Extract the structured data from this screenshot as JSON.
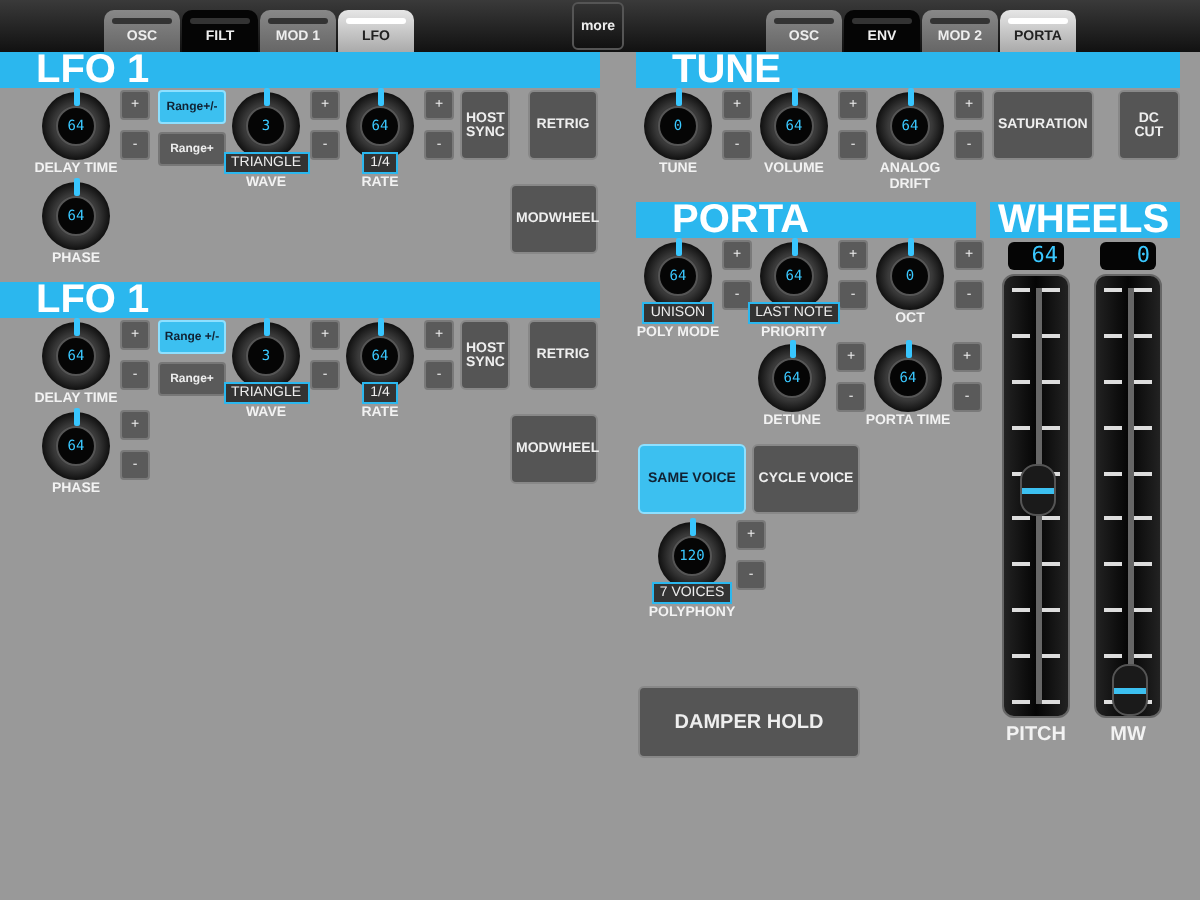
{
  "tabs_left": [
    {
      "label": "OSC",
      "selected": false,
      "dark": false
    },
    {
      "label": "FILT",
      "selected": false,
      "dark": true
    },
    {
      "label": "MOD 1",
      "selected": false,
      "dark": false
    },
    {
      "label": "LFO",
      "selected": true,
      "dark": false
    }
  ],
  "more": "more",
  "tabs_right": [
    {
      "label": "OSC",
      "selected": false,
      "dark": false
    },
    {
      "label": "ENV",
      "selected": false,
      "dark": true
    },
    {
      "label": "MOD 2",
      "selected": false,
      "dark": false
    },
    {
      "label": "PORTA",
      "selected": true,
      "dark": false
    }
  ],
  "lfo_sections": [
    {
      "title": "LFO 1",
      "delay": {
        "value": "64",
        "label": "DELAY TIME",
        "stepper": [
          "+",
          "-"
        ]
      },
      "range_buttons": [
        {
          "label": "Range+/-",
          "selected": true
        },
        {
          "label": "Range+",
          "selected": false
        }
      ],
      "wave": {
        "value": "3",
        "display": "TRIANGLE",
        "label": "WAVE",
        "stepper": [
          "+",
          "-"
        ]
      },
      "rate": {
        "value": "64",
        "display": "1/4",
        "label": "RATE",
        "stepper": [
          "+",
          "-"
        ]
      },
      "host_sync": "HOST SYNC",
      "retrig": "RETRIG",
      "modwheel": "MODWHEEL",
      "phase": {
        "value": "64",
        "label": "PHASE"
      }
    },
    {
      "title": "LFO 1",
      "delay": {
        "value": "64",
        "label": "DELAY TIME",
        "stepper": [
          "+",
          "-"
        ]
      },
      "range_buttons": [
        {
          "label": "Range +/-",
          "selected": true
        },
        {
          "label": "Range+",
          "selected": false
        }
      ],
      "wave": {
        "value": "3",
        "display": "TRIANGLE",
        "label": "WAVE",
        "stepper": [
          "+",
          "-"
        ]
      },
      "rate": {
        "value": "64",
        "display": "1/4",
        "label": "RATE",
        "stepper": [
          "+",
          "-"
        ]
      },
      "host_sync": "HOST SYNC",
      "retrig": "RETRIG",
      "modwheel": "MODWHEEL",
      "phase": {
        "value": "64",
        "label": "PHASE",
        "stepper": [
          "+",
          "-"
        ]
      }
    }
  ],
  "tune": {
    "title": "TUNE",
    "knobs": [
      {
        "value": "0",
        "label": "TUNE",
        "stepper": [
          "+",
          "-"
        ]
      },
      {
        "value": "64",
        "label": "VOLUME",
        "stepper": [
          "+",
          "-"
        ]
      },
      {
        "value": "64",
        "label": "ANALOG DRIFT",
        "stepper": [
          "+",
          "-"
        ]
      }
    ],
    "buttons": [
      "SATURATION",
      "DC CUT"
    ]
  },
  "porta": {
    "title": "PORTA",
    "knobs_row1": [
      {
        "value": "64",
        "display": "UNISON",
        "label": "POLY MODE",
        "stepper": [
          "+",
          "-"
        ]
      },
      {
        "value": "64",
        "display": "LAST NOTE",
        "label": "PRIORITY",
        "stepper": [
          "+",
          "-"
        ]
      },
      {
        "value": "0",
        "label": "OCT",
        "stepper": [
          "+",
          "-"
        ]
      }
    ],
    "knobs_row2": [
      {
        "value": "64",
        "label": "DETUNE",
        "stepper": [
          "+",
          "-"
        ]
      },
      {
        "value": "64",
        "label": "PORTA TIME",
        "stepper": [
          "+",
          "-"
        ]
      }
    ],
    "voice_buttons": [
      {
        "label": "SAME VOICE",
        "selected": true
      },
      {
        "label": "CYCLE VOICE",
        "selected": false
      }
    ],
    "polyphony": {
      "value": "120",
      "display": "7 VOICES",
      "label": "POLYPHONY",
      "stepper": [
        "+",
        "-"
      ]
    },
    "damper": "DAMPER HOLD"
  },
  "wheels": {
    "title": "WHEELS",
    "sliders": [
      {
        "value": "64",
        "kind": "pitch",
        "label": "PITCH"
      },
      {
        "value": "0",
        "kind": "mod",
        "label": "MW"
      }
    ]
  }
}
